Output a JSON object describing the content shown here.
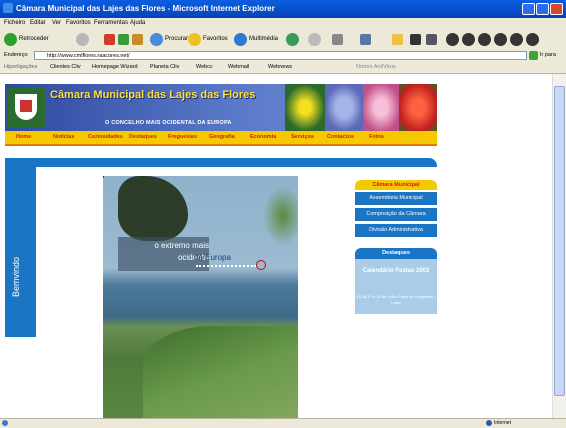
{
  "window": {
    "title": "Câmara Municipal das Lajes das Flores - Microsoft Internet Explorer"
  },
  "menubar": {
    "items": [
      "Ficheiro",
      "Editar",
      "Ver",
      "Favoritos",
      "Ferramentas",
      "Ajuda"
    ]
  },
  "toolbar": {
    "back_label": "Retroceder",
    "search_label": "Procurar",
    "favorites_label": "Favoritos",
    "media_label": "Multimédia"
  },
  "address": {
    "label": "Endereço",
    "url": "http://www.cmlflores.raacores.net/",
    "go_label": "Ir para"
  },
  "links": {
    "label": "Hiperligações",
    "items": [
      "Clientes Cliv",
      "Homepage Wizard",
      "Planeta Cliv",
      "Webcc",
      "Webmail",
      "Webnews",
      "Norton AntiVirus"
    ]
  },
  "site": {
    "title": "Câmara Municipal das Lajes das Flores",
    "subtitle": "O CONCELHO MAIS OCIDENTAL DA EUROPA",
    "nav": [
      "Home",
      "Notícias",
      "Curiosidades",
      "Destaques",
      "Freguesias",
      "Geografia",
      "Economia",
      "Serviços",
      "Contactos",
      "Fotos"
    ],
    "welcome": "Bemvindo",
    "photo_caption_1": "o extremo mais",
    "photo_caption_2": "ocidental",
    "photo_caption_3": "da Europa"
  },
  "sidebar": {
    "header": "Câmara Municipal",
    "items": [
      "Assembleia Municipal",
      "Composição da Câmara",
      "Divisão Administrativa"
    ],
    "destaques_header": "Destaques",
    "destaques_title": "Calendário Festas 2003",
    "destaques_sub": "15,16,17 e 22 de Julho Festa do Emigrante - Lajes"
  },
  "status": {
    "zone": "Internet"
  },
  "colors": {
    "accent_yellow": "#f5c800",
    "site_blue": "#1a75c4",
    "nav_text": "#cc2200"
  }
}
